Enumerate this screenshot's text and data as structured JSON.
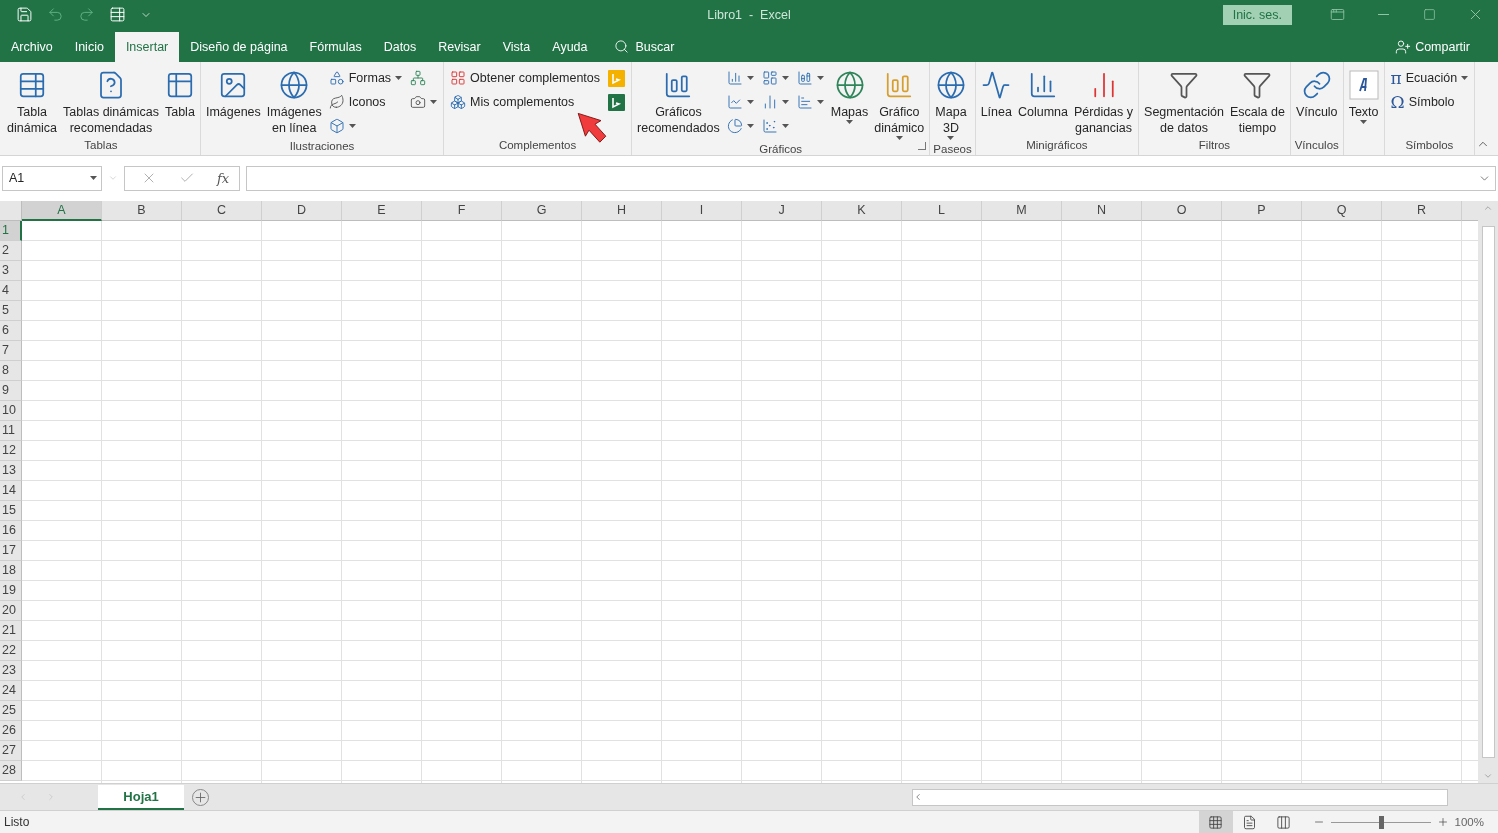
{
  "title_bar": {
    "title": "Libro1  -  Excel",
    "sign_in": "Inic. ses."
  },
  "tabs": [
    {
      "label": "Archivo",
      "selected": false
    },
    {
      "label": "Inicio",
      "selected": false
    },
    {
      "label": "Insertar",
      "selected": true
    },
    {
      "label": "Diseño de página",
      "selected": false
    },
    {
      "label": "Fórmulas",
      "selected": false
    },
    {
      "label": "Datos",
      "selected": false
    },
    {
      "label": "Revisar",
      "selected": false
    },
    {
      "label": "Vista",
      "selected": false
    },
    {
      "label": "Ayuda",
      "selected": false
    }
  ],
  "search": {
    "label": "Buscar"
  },
  "share": {
    "label": "Compartir"
  },
  "ribbon": {
    "groups": [
      {
        "name": "Tablas",
        "dialog_launcher": false,
        "items": [
          {
            "kind": "large",
            "lines": [
              "Tabla",
              "dinámica"
            ],
            "dropdown": false
          },
          {
            "kind": "large",
            "lines": [
              "Tablas dinámicas",
              "recomendadas"
            ],
            "dropdown": false
          },
          {
            "kind": "large",
            "lines": [
              "Tabla"
            ],
            "dropdown": false
          }
        ]
      },
      {
        "name": "Ilustraciones",
        "dialog_launcher": false,
        "items": [
          {
            "kind": "large",
            "lines": [
              "Imágenes"
            ],
            "dropdown": false
          },
          {
            "kind": "large",
            "lines": [
              "Imágenes",
              "en línea"
            ],
            "dropdown": false
          },
          {
            "kind": "stack",
            "items": [
              {
                "kind": "small",
                "label": "Formas",
                "dropdown": true
              },
              {
                "kind": "small",
                "label": "Iconos",
                "dropdown": false
              },
              {
                "kind": "icon",
                "dropdown": true
              }
            ]
          },
          {
            "kind": "stack",
            "items": [
              {
                "kind": "icon",
                "dropdown": false
              },
              {
                "kind": "icon",
                "dropdown": true
              }
            ]
          }
        ]
      },
      {
        "name": "Complementos",
        "dialog_launcher": false,
        "items": [
          {
            "kind": "stack",
            "items": [
              {
                "kind": "small",
                "label": "Obtener complementos",
                "dropdown": false
              },
              {
                "kind": "small",
                "label": "Mis complementos",
                "dropdown": false
              }
            ]
          },
          {
            "kind": "stack",
            "items": [
              {
                "kind": "icon",
                "dropdown": false
              },
              {
                "kind": "icon",
                "dropdown": false
              }
            ]
          }
        ]
      },
      {
        "name": "Gráficos",
        "dialog_launcher": true,
        "items": [
          {
            "kind": "large",
            "lines": [
              "Gráficos",
              "recomendados"
            ],
            "dropdown": false
          },
          {
            "kind": "stack",
            "items": [
              {
                "kind": "icon",
                "dropdown": true
              },
              {
                "kind": "icon",
                "dropdown": true
              },
              {
                "kind": "icon",
                "dropdown": true
              }
            ]
          },
          {
            "kind": "stack",
            "items": [
              {
                "kind": "icon",
                "dropdown": true
              },
              {
                "kind": "icon",
                "dropdown": true
              },
              {
                "kind": "icon",
                "dropdown": true
              }
            ]
          },
          {
            "kind": "stack",
            "items": [
              {
                "kind": "icon",
                "dropdown": true
              },
              {
                "kind": "icon",
                "dropdown": true
              }
            ]
          },
          {
            "kind": "large",
            "lines": [
              "Mapas"
            ],
            "dropdown": true
          },
          {
            "kind": "large",
            "lines": [
              "Gráfico",
              "dinámico"
            ],
            "dropdown": true
          }
        ]
      },
      {
        "name": "Paseos",
        "dialog_launcher": false,
        "items": [
          {
            "kind": "large",
            "lines": [
              "Mapa",
              "3D"
            ],
            "dropdown": true
          }
        ]
      },
      {
        "name": "Minigráficos",
        "dialog_launcher": false,
        "items": [
          {
            "kind": "large",
            "lines": [
              "Línea"
            ],
            "dropdown": false
          },
          {
            "kind": "large",
            "lines": [
              "Columna"
            ],
            "dropdown": false
          },
          {
            "kind": "large",
            "lines": [
              "Pérdidas y",
              "ganancias"
            ],
            "dropdown": false
          }
        ]
      },
      {
        "name": "Filtros",
        "dialog_launcher": false,
        "items": [
          {
            "kind": "large",
            "lines": [
              "Segmentación",
              "de datos"
            ],
            "dropdown": false
          },
          {
            "kind": "large",
            "lines": [
              "Escala de",
              "tiempo"
            ],
            "dropdown": false
          }
        ]
      },
      {
        "name": "Vínculos",
        "dialog_launcher": false,
        "items": [
          {
            "kind": "large",
            "lines": [
              "Vínculo"
            ],
            "dropdown": false
          }
        ]
      },
      {
        "dialog_launcher": false,
        "items": [
          {
            "kind": "large",
            "lines": [
              "Texto"
            ],
            "dropdown": true
          }
        ]
      },
      {
        "name": "Símbolos",
        "dialog_launcher": false,
        "items": [
          {
            "kind": "stack",
            "items": [
              {
                "kind": "small",
                "glyph": "π",
                "label": "Ecuación",
                "dropdown": true
              },
              {
                "kind": "small",
                "glyph": "Ω",
                "label": "Símbolo",
                "dropdown": false
              }
            ]
          }
        ]
      }
    ]
  },
  "annotation": {
    "kind": "arrow"
  },
  "formula_bar": {
    "cell": "A1",
    "function_label": "fx"
  },
  "grid": {
    "columns": [
      {
        "label": "A",
        "selected": true
      },
      {
        "label": "B",
        "selected": false
      },
      {
        "label": "C",
        "selected": false
      },
      {
        "label": "D",
        "selected": false
      },
      {
        "label": "E",
        "selected": false
      },
      {
        "label": "F",
        "selected": false
      },
      {
        "label": "G",
        "selected": false
      },
      {
        "label": "H",
        "selected": false
      },
      {
        "label": "I",
        "selected": false
      },
      {
        "label": "J",
        "selected": false
      },
      {
        "label": "K",
        "selected": false
      },
      {
        "label": "L",
        "selected": false
      },
      {
        "label": "M",
        "selected": false
      },
      {
        "label": "N",
        "selected": false
      },
      {
        "label": "O",
        "selected": false
      },
      {
        "label": "P",
        "selected": false
      },
      {
        "label": "Q",
        "selected": false
      },
      {
        "label": "R",
        "selected": false
      }
    ],
    "rows": [
      {
        "label": "1",
        "selected": true
      },
      {
        "label": "2",
        "selected": false
      },
      {
        "label": "3",
        "selected": false
      },
      {
        "label": "4",
        "selected": false
      },
      {
        "label": "5",
        "selected": false
      },
      {
        "label": "6",
        "selected": false
      },
      {
        "label": "7",
        "selected": false
      },
      {
        "label": "8",
        "selected": false
      },
      {
        "label": "9",
        "selected": false
      },
      {
        "label": "10",
        "selected": false
      },
      {
        "label": "11",
        "selected": false
      },
      {
        "label": "12",
        "selected": false
      },
      {
        "label": "13",
        "selected": false
      },
      {
        "label": "14",
        "selected": false
      },
      {
        "label": "15",
        "selected": false
      },
      {
        "label": "16",
        "selected": false
      },
      {
        "label": "17",
        "selected": false
      },
      {
        "label": "18",
        "selected": false
      },
      {
        "label": "19",
        "selected": false
      },
      {
        "label": "20",
        "selected": false
      },
      {
        "label": "21",
        "selected": false
      },
      {
        "label": "22",
        "selected": false
      },
      {
        "label": "23",
        "selected": false
      },
      {
        "label": "24",
        "selected": false
      },
      {
        "label": "25",
        "selected": false
      },
      {
        "label": "26",
        "selected": false
      },
      {
        "label": "27",
        "selected": false
      },
      {
        "label": "28",
        "selected": false
      }
    ]
  },
  "sheets": [
    {
      "label": "Hoja1",
      "selected": true
    }
  ],
  "status_bar": {
    "text": "Listo",
    "views": [
      {
        "selected": true
      },
      {
        "selected": false
      },
      {
        "selected": false
      }
    ],
    "zoom": {
      "level": 0.5,
      "reading": "100%"
    }
  }
}
